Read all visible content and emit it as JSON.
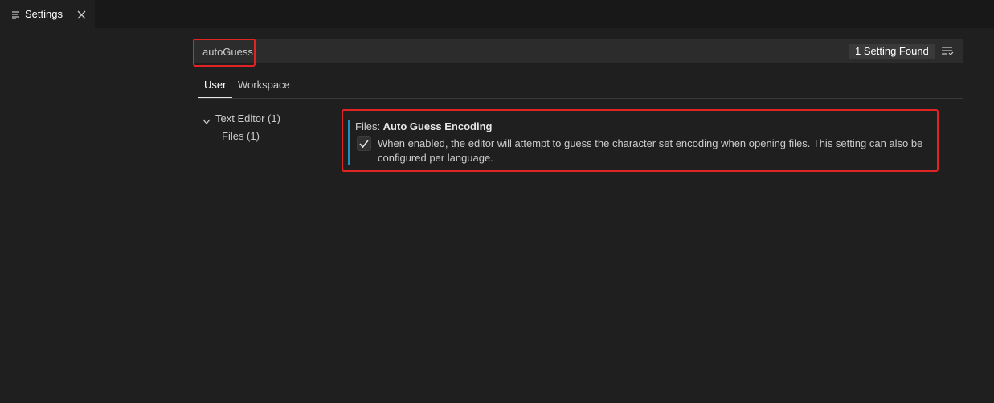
{
  "tab": {
    "label": "Settings",
    "icon": "settings-list-icon",
    "close_icon": "close-icon"
  },
  "search": {
    "value": "autoGuess",
    "result_count": "1 Setting Found",
    "filter_icon": "filter-icon"
  },
  "scopes": [
    {
      "label": "User",
      "active": true
    },
    {
      "label": "Workspace",
      "active": false
    }
  ],
  "toc": {
    "text_editor": "Text Editor (1)",
    "files": "Files (1)"
  },
  "setting": {
    "category": "Files: ",
    "name": "Auto Guess Encoding",
    "checked": true,
    "description": "When enabled, the editor will attempt to guess the character set encoding when opening files. This setting can also be configured per language."
  },
  "colors": {
    "background": "#1f1f1f",
    "highlight_box": "#e02424",
    "modified_bar": "#1e8fbf"
  }
}
